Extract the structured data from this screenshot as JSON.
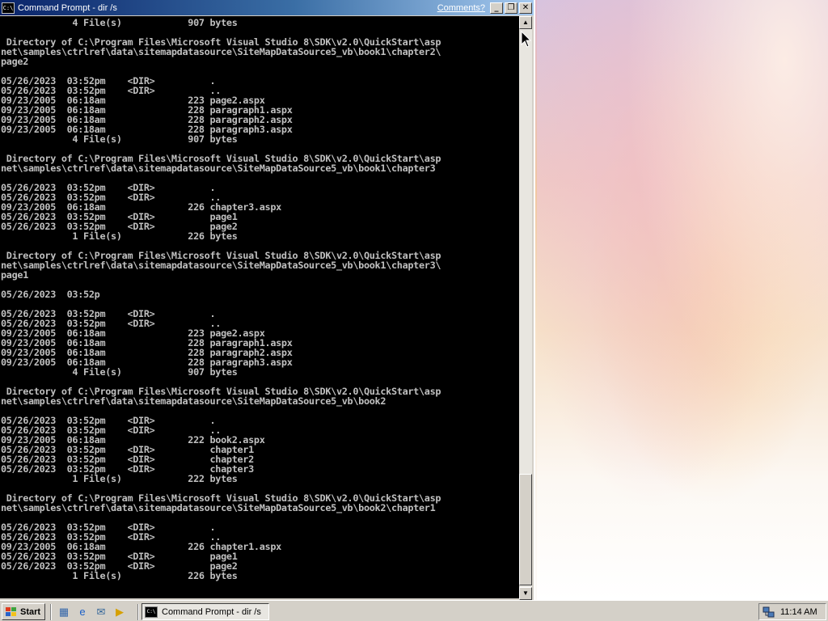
{
  "window": {
    "title": "Command Prompt - dir /s",
    "comments_link": "Comments?",
    "icon_label": "C:\\",
    "minimize_glyph": "_",
    "maximize_glyph": "❐",
    "close_glyph": "✕"
  },
  "console_lines": [
    "             4 File(s)            907 bytes",
    "",
    " Directory of C:\\Program Files\\Microsoft Visual Studio 8\\SDK\\v2.0\\QuickStart\\asp",
    "net\\samples\\ctrlref\\data\\sitemapdatasource\\SiteMapDataSource5_vb\\book1\\chapter2\\",
    "page2",
    "",
    "05/26/2023  03:52pm    <DIR>          .",
    "05/26/2023  03:52pm    <DIR>          ..",
    "09/23/2005  06:18am               223 page2.aspx",
    "09/23/2005  06:18am               228 paragraph1.aspx",
    "09/23/2005  06:18am               228 paragraph2.aspx",
    "09/23/2005  06:18am               228 paragraph3.aspx",
    "             4 File(s)            907 bytes",
    "",
    " Directory of C:\\Program Files\\Microsoft Visual Studio 8\\SDK\\v2.0\\QuickStart\\asp",
    "net\\samples\\ctrlref\\data\\sitemapdatasource\\SiteMapDataSource5_vb\\book1\\chapter3",
    "",
    "05/26/2023  03:52pm    <DIR>          .",
    "05/26/2023  03:52pm    <DIR>          ..",
    "09/23/2005  06:18am               226 chapter3.aspx",
    "05/26/2023  03:52pm    <DIR>          page1",
    "05/26/2023  03:52pm    <DIR>          page2",
    "             1 File(s)            226 bytes",
    "",
    " Directory of C:\\Program Files\\Microsoft Visual Studio 8\\SDK\\v2.0\\QuickStart\\asp",
    "net\\samples\\ctrlref\\data\\sitemapdatasource\\SiteMapDataSource5_vb\\book1\\chapter3\\",
    "page1",
    "",
    "05/26/2023  03:52p",
    "",
    "05/26/2023  03:52pm    <DIR>          .",
    "05/26/2023  03:52pm    <DIR>          ..",
    "09/23/2005  06:18am               223 page2.aspx",
    "09/23/2005  06:18am               228 paragraph1.aspx",
    "09/23/2005  06:18am               228 paragraph2.aspx",
    "09/23/2005  06:18am               228 paragraph3.aspx",
    "             4 File(s)            907 bytes",
    "",
    " Directory of C:\\Program Files\\Microsoft Visual Studio 8\\SDK\\v2.0\\QuickStart\\asp",
    "net\\samples\\ctrlref\\data\\sitemapdatasource\\SiteMapDataSource5_vb\\book2",
    "",
    "05/26/2023  03:52pm    <DIR>          .",
    "05/26/2023  03:52pm    <DIR>          ..",
    "09/23/2005  06:18am               222 book2.aspx",
    "05/26/2023  03:52pm    <DIR>          chapter1",
    "05/26/2023  03:52pm    <DIR>          chapter2",
    "05/26/2023  03:52pm    <DIR>          chapter3",
    "             1 File(s)            222 bytes",
    "",
    " Directory of C:\\Program Files\\Microsoft Visual Studio 8\\SDK\\v2.0\\QuickStart\\asp",
    "net\\samples\\ctrlref\\data\\sitemapdatasource\\SiteMapDataSource5_vb\\book2\\chapter1",
    "",
    "05/26/2023  03:52pm    <DIR>          .",
    "05/26/2023  03:52pm    <DIR>          ..",
    "09/23/2005  06:18am               226 chapter1.aspx",
    "05/26/2023  03:52pm    <DIR>          page1",
    "05/26/2023  03:52pm    <DIR>          page2",
    "             1 File(s)            226 bytes",
    "",
    "                                      _"
  ],
  "scrollbar": {
    "up_glyph": "▲",
    "down_glyph": "▼"
  },
  "taskbar": {
    "start_label": "Start",
    "task_label": "Command Prompt - dir /s",
    "task_icon_label": "C:\\",
    "clock": "11:14 AM",
    "quick_launch": [
      {
        "name": "desktop-icon",
        "glyph": "▦",
        "color": "#3366aa"
      },
      {
        "name": "internet-explorer-icon",
        "glyph": "e",
        "color": "#1a5fc8"
      },
      {
        "name": "outlook-express-icon",
        "glyph": "✉",
        "color": "#336699"
      },
      {
        "name": "media-player-icon",
        "glyph": "▶",
        "color": "#d6a000"
      }
    ]
  },
  "colors": {
    "console_bg": "#000000",
    "console_fg": "#c0c0c0",
    "title_active": "#0a246a",
    "chrome": "#d4d0c8"
  }
}
